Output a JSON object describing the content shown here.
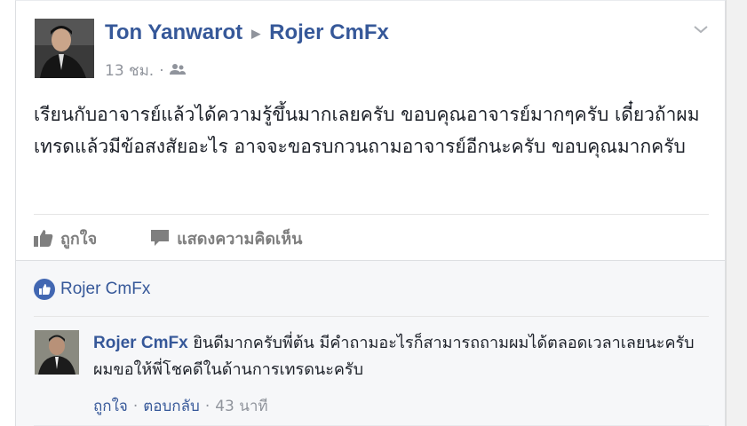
{
  "post": {
    "author": "Ton Yanwarot",
    "target": "Rojer CmFx",
    "time": "13 ชม.",
    "privacy_icon": "friends-icon",
    "text": "เรียนกับอาจารย์แล้วได้ความรู้ขึ้นมากเลยครับ ขอบคุณอาจารย์มากๆครับ เดี๋ยวถ้าผมเทรดแล้วมีข้อสงสัยอะไร อาจจะขอรบกวนถามอาจารย์อีกนะครับ ขอบคุณมากครับ"
  },
  "actions": {
    "like": "ถูกใจ",
    "comment": "แสดงความคิดเห็น"
  },
  "likes": {
    "name": "Rojer CmFx"
  },
  "comment": {
    "author": "Rojer CmFx",
    "text": "ยินดีมากครับพี่ต้น มีคำถามอะไรก็สามารถถามผมได้ตลอดเวลาเลยนะครับ ผมขอให้พี่โชคดีในด้านการเทรดนะครับ",
    "like": "ถูกใจ",
    "reply": "ตอบกลับ",
    "time": "43 นาที"
  },
  "colors": {
    "link": "#365899",
    "meta": "#90949c",
    "like_badge": "#4267b2"
  }
}
